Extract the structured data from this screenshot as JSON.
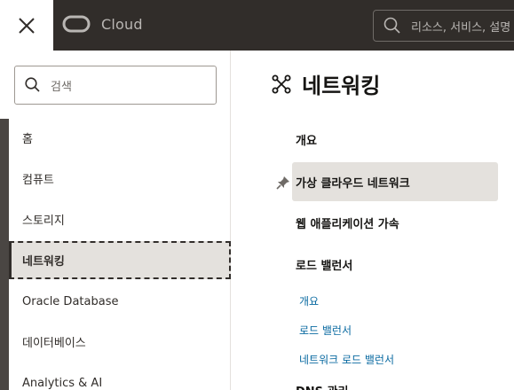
{
  "topbar": {
    "brand": "Cloud",
    "search_placeholder": "리소스, 서비스, 설명"
  },
  "left_nav": {
    "search_placeholder": "검색",
    "items": [
      {
        "label": "홈"
      },
      {
        "label": "컴퓨트"
      },
      {
        "label": "스토리지"
      },
      {
        "label": "네트워킹",
        "active": true
      },
      {
        "label": "Oracle Database"
      },
      {
        "label": "데이터베이스"
      },
      {
        "label": "Analytics & AI"
      }
    ]
  },
  "panel": {
    "title": "네트워킹",
    "items": [
      {
        "label": "개요"
      },
      {
        "label": "가상 클라우드 네트워크",
        "pinned": true
      },
      {
        "label": "웹 애플리케이션 가속"
      },
      {
        "label": "로드 밸런서"
      }
    ],
    "sublinks": [
      "개요",
      "로드 밸런서",
      "네트워크 로드 밸런서"
    ],
    "cut_item": "DNS 관리"
  },
  "colors": {
    "topbar": "#312d2a",
    "link": "#0a6aa1",
    "highlight": "#e4e1dd"
  }
}
